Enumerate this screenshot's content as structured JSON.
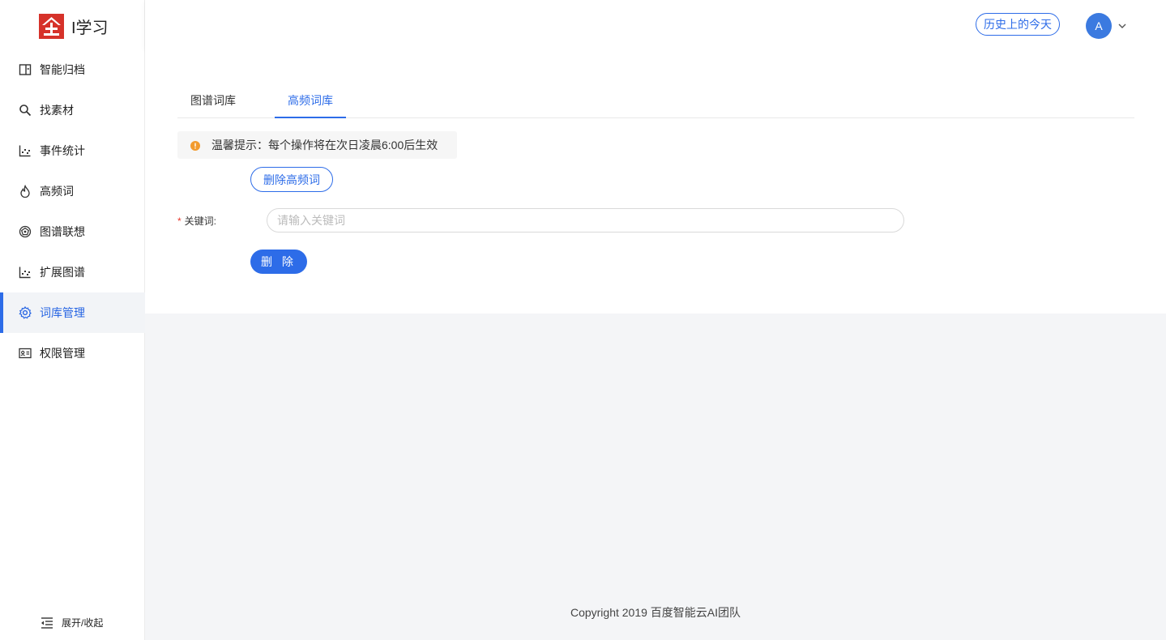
{
  "app": {
    "name": "I学习"
  },
  "sidebar": {
    "items": [
      {
        "label": "智能归档",
        "icon": "archive-icon"
      },
      {
        "label": "找素材",
        "icon": "search-icon"
      },
      {
        "label": "事件统计",
        "icon": "chart-icon"
      },
      {
        "label": "高频词",
        "icon": "flame-icon"
      },
      {
        "label": "图谱联想",
        "icon": "graph-icon"
      },
      {
        "label": "扩展图谱",
        "icon": "chart-icon"
      },
      {
        "label": "词库管理",
        "icon": "gear-icon",
        "active": true
      },
      {
        "label": "权限管理",
        "icon": "id-card-icon"
      }
    ],
    "collapse_label": "展开/收起"
  },
  "header": {
    "history_label": "历史上的今天",
    "avatar_letter": "A"
  },
  "tabs": [
    {
      "label": "图谱词库"
    },
    {
      "label": "高频词库",
      "active": true
    }
  ],
  "tip": {
    "text": "温馨提示：每个操作将在次日凌晨6:00后生效"
  },
  "form": {
    "delete_hf_label": "删除高频词",
    "keyword_label": "关键词:",
    "keyword_placeholder": "请输入关键词",
    "keyword_value": "",
    "delete_label": "删 除"
  },
  "footer": {
    "text": "Copyright 2019 百度智能云AI团队"
  },
  "colors": {
    "accent": "#2d6ce8",
    "logo_red": "#d6322a",
    "warning": "#f29b2f"
  }
}
